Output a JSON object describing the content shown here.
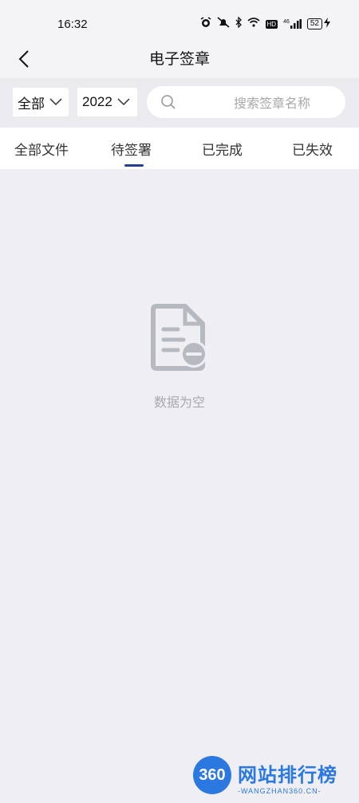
{
  "status_bar": {
    "time": "16:32",
    "icons": [
      "alarm-icon",
      "mute-icon",
      "bluetooth-icon",
      "wifi-icon",
      "hd-icon",
      "signal-icon",
      "battery-icon",
      "charging-icon"
    ],
    "hd_label": "HD",
    "signal_label": "46",
    "battery_level": "52"
  },
  "nav": {
    "title": "电子签章",
    "back_icon": "chevron-left-icon"
  },
  "filters": {
    "scope_value": "全部",
    "year_value": "2022",
    "search_placeholder": "搜索签章名称"
  },
  "tabs": [
    {
      "label": "全部文件",
      "active": false
    },
    {
      "label": "待签署",
      "active": true
    },
    {
      "label": "已完成",
      "active": false
    },
    {
      "label": "已失效",
      "active": false
    }
  ],
  "empty_state": {
    "icon": "empty-document-icon",
    "text": "数据为空"
  },
  "watermark": {
    "logo_text": "360",
    "title": "网站排行榜",
    "subtitle": "-WANGZHAN360.CN-"
  },
  "colors": {
    "accent": "#1f3f8f",
    "background": "#eeeef3",
    "muted_text": "#a9a9ae",
    "watermark": "#2a78e0"
  }
}
